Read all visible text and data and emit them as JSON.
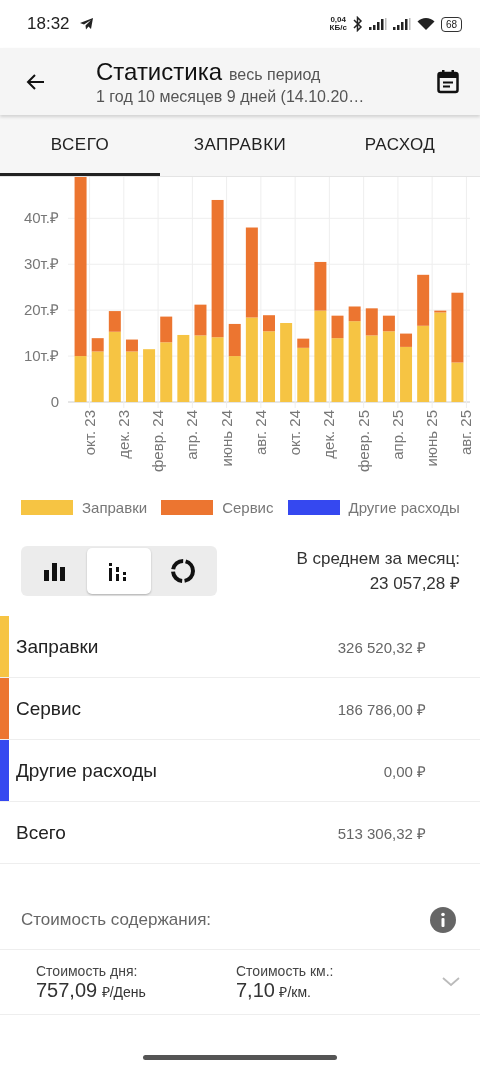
{
  "status_bar": {
    "time": "18:32",
    "speed_value": "0,04",
    "speed_unit": "КБ/с",
    "battery": "68"
  },
  "app_bar": {
    "title": "Статистика",
    "period": "весь период",
    "subtitle": "1 год 10 месяцев 9 дней (14.10.20…"
  },
  "tabs": [
    {
      "label": "ВСЕГО",
      "selected": true
    },
    {
      "label": "ЗАПРАВКИ",
      "selected": false
    },
    {
      "label": "РАСХОД",
      "selected": false
    }
  ],
  "chart": {
    "chart_data": {
      "type": "bar",
      "stacked": true,
      "grid": true,
      "categories": [
        "окт. 23",
        null,
        "дек. 23",
        null,
        "февр. 24",
        null,
        "апр. 24",
        null,
        "июнь 24",
        null,
        "авг. 24",
        null,
        "окт. 24",
        null,
        "дек. 24",
        null,
        "февр. 25",
        null,
        "апр. 25",
        null,
        "июнь 25",
        null,
        "авг. 25"
      ],
      "ylim": [
        0,
        49
      ],
      "yticks": [
        {
          "value": 0,
          "label": "0"
        },
        {
          "value": 10,
          "label": "10т.₽"
        },
        {
          "value": 20,
          "label": "20т.₽"
        },
        {
          "value": 30,
          "label": "30т.₽"
        },
        {
          "value": 40,
          "label": "40т.₽"
        }
      ],
      "series": [
        {
          "name": "Заправки",
          "color": "#f6c443",
          "values": [
            10.0,
            11.0,
            15.3,
            11.0,
            11.5,
            13.0,
            14.6,
            14.5,
            14.1,
            10.0,
            18.4,
            15.4,
            17.2,
            11.8,
            19.9,
            13.9,
            17.6,
            14.5,
            15.4,
            12.0,
            16.6,
            19.5,
            8.6
          ]
        },
        {
          "name": "Сервис",
          "color": "#ec7530",
          "values": [
            39.0,
            2.9,
            4.5,
            2.6,
            0,
            5.6,
            0,
            6.7,
            29.9,
            7.0,
            19.6,
            3.5,
            0,
            2.0,
            10.6,
            4.9,
            3.2,
            5.9,
            3.4,
            2.9,
            11.1,
            0.4,
            15.2
          ]
        },
        {
          "name": "Другие расходы",
          "color": "#3548f0",
          "values": [
            0,
            0,
            0,
            0,
            0,
            0,
            0,
            0,
            0,
            0,
            0,
            0,
            0,
            0,
            0,
            0,
            0,
            0,
            0,
            0,
            0,
            0,
            0
          ]
        }
      ]
    }
  },
  "chart_modes": [
    {
      "kind": "bars",
      "selected": false
    },
    {
      "kind": "stacked",
      "selected": true
    },
    {
      "kind": "donut",
      "selected": false
    }
  ],
  "average": {
    "label": "В среднем за месяц:",
    "value": "23 057,28 ₽"
  },
  "totals": [
    {
      "label": "Заправки",
      "amount": "326 520,32 ₽",
      "color": "#f6c443"
    },
    {
      "label": "Сервис",
      "amount": "186 786,00 ₽",
      "color": "#ec7530"
    },
    {
      "label": "Другие расходы",
      "amount": "0,00 ₽",
      "color": "#3548f0"
    },
    {
      "label": "Всего",
      "amount": "513 306,32 ₽"
    }
  ],
  "upkeep": {
    "title": "Стоимость содержания:",
    "items": [
      {
        "label": "Стоимость дня:",
        "value": "757,09",
        "unit": "₽/День"
      },
      {
        "label": "Стоимость км.:",
        "value": "7,10",
        "unit": "₽/км."
      }
    ]
  }
}
